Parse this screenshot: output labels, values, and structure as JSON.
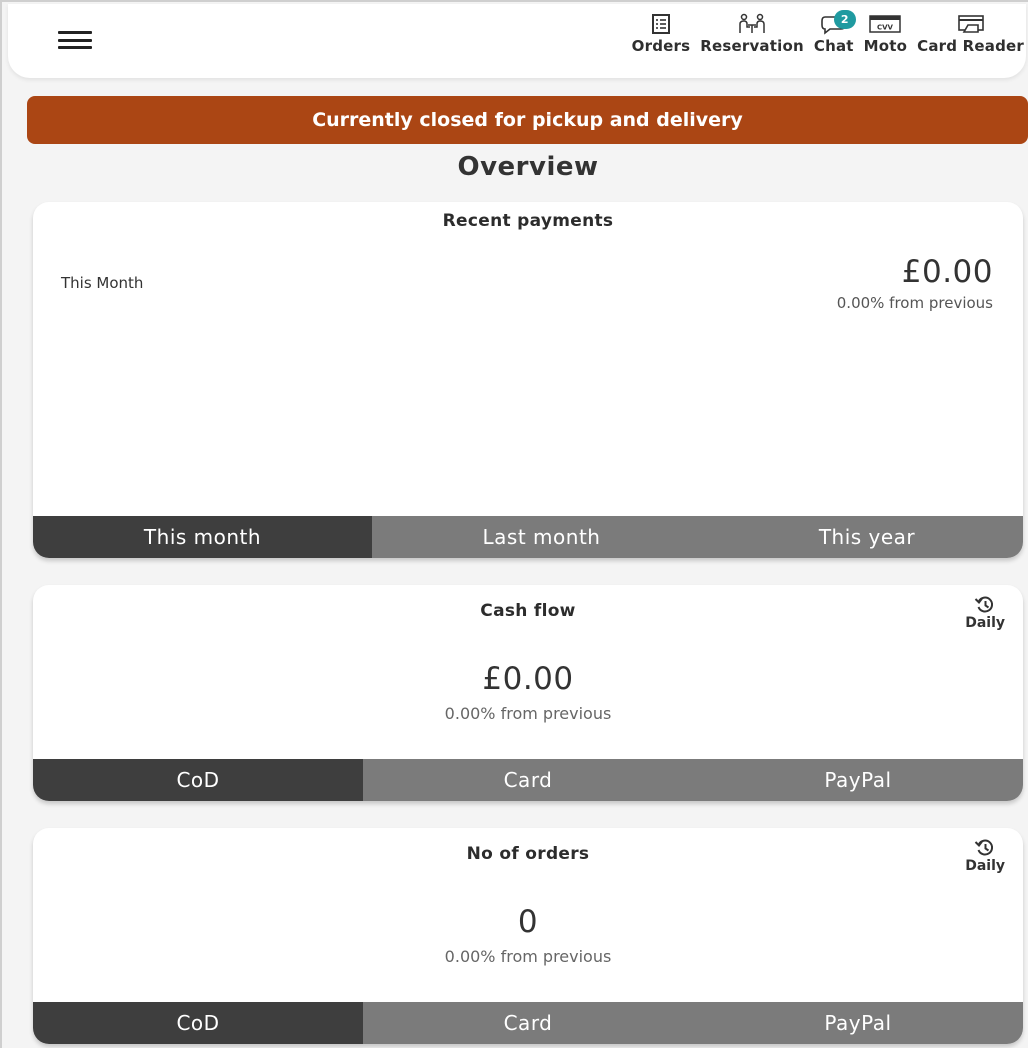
{
  "header": {
    "nav": [
      {
        "label": "Orders",
        "icon": "orders-icon"
      },
      {
        "label": "Reservation",
        "icon": "reservation-icon"
      },
      {
        "label": "Chat",
        "icon": "chat-icon",
        "badge": "2"
      },
      {
        "label": "Moto",
        "icon": "cvv-card-icon",
        "icon_text": "CVV"
      },
      {
        "label": "Card Reader",
        "icon": "card-reader-icon"
      }
    ]
  },
  "banner": {
    "text": "Currently closed for pickup and delivery",
    "color": "#ab4614"
  },
  "overview": {
    "title": "Overview"
  },
  "recent_payments": {
    "title": "Recent payments",
    "period_label": "This Month",
    "amount": "£0.00",
    "change": "0.00% from previous",
    "tabs": [
      "This month",
      "Last month",
      "This year"
    ],
    "active_tab": "This month"
  },
  "cash_flow": {
    "title": "Cash flow",
    "frequency": "Daily",
    "amount": "£0.00",
    "change": "0.00% from previous",
    "tabs": [
      "CoD",
      "Card",
      "PayPal"
    ],
    "active_tab": "CoD"
  },
  "orders": {
    "title": "No of orders",
    "frequency": "Daily",
    "count": "0",
    "change": "0.00% from previous",
    "tabs": [
      "CoD",
      "Card",
      "PayPal"
    ],
    "active_tab": "CoD"
  },
  "colors": {
    "tab_active": "#3e3e3e",
    "tab_inactive": "#7b7b7b",
    "badge": "#1f9aa0"
  }
}
